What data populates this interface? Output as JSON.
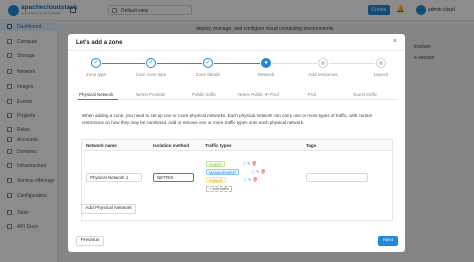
{
  "header": {
    "logo_text": "apachecloudstack",
    "logo_sub": "open source cloud computing",
    "view_select": "Default view",
    "create_label": "Create",
    "user_name": "admin cloud"
  },
  "sidebar": {
    "items": [
      {
        "label": "Dashboard",
        "icon": "dashboard-icon",
        "active": true
      },
      {
        "label": "Compute",
        "icon": "cloud-icon"
      },
      {
        "label": "Storage",
        "icon": "database-icon"
      },
      {
        "label": "Network",
        "icon": "wifi-icon"
      },
      {
        "label": "Images",
        "icon": "picture-icon"
      },
      {
        "label": "Events",
        "icon": "schedule-icon"
      },
      {
        "label": "Projects",
        "icon": "project-icon"
      },
      {
        "label": "Roles",
        "icon": "idcard-icon"
      },
      {
        "label": "Accounts",
        "icon": "team-icon"
      },
      {
        "label": "Domains",
        "icon": "block-icon"
      },
      {
        "label": "Infrastructure",
        "icon": "bank-icon"
      },
      {
        "label": "Service offerings",
        "icon": "shopping-icon"
      },
      {
        "label": "Configuration",
        "icon": "setting-icon"
      },
      {
        "label": "Tools",
        "icon": "tool-icon"
      },
      {
        "label": "API Docs",
        "icon": "read-icon"
      }
    ]
  },
  "background_text": {
    "line1": "deploy, manage, and configure cloud computing environments",
    "right1": "tructure",
    "right2": "e version"
  },
  "modal": {
    "title": "Let's add a zone",
    "close_glyph": "×",
    "steps": [
      {
        "label": "Zone type",
        "state": "done"
      },
      {
        "label": "Core zone type",
        "state": "done"
      },
      {
        "label": "Zone details",
        "state": "done"
      },
      {
        "label": "Network",
        "state": "current"
      },
      {
        "label": "Add resources",
        "state": "pending"
      },
      {
        "label": "Launch",
        "state": "pending"
      }
    ],
    "subtabs": [
      "Physical Network",
      "Netris Provider",
      "Public traffic",
      "Netris Public IP Pool",
      "Pod",
      "Guest traffic"
    ],
    "description": {
      "line1": "When adding a zone, you need to set up one or more physical networks. Each physical network can carry one or more types of traffic, with certain",
      "line2": "restrictions on how they may be combined. Add or remove one or more traffic types onto each physical network."
    },
    "table": {
      "headers": [
        "Network name",
        "Isolation method",
        "Traffic types",
        "Tags"
      ],
      "rows": [
        {
          "network_name": "Physical Network 1",
          "isolation_method": "NETRIS",
          "traffic_types": [
            {
              "label": "GUEST",
              "color": "#52c41a",
              "bg": "#f6ffed",
              "border": "#b7eb8f"
            },
            {
              "label": "MANAGEMENT",
              "color": "#1e8bd6",
              "bg": "#e6f4ff",
              "border": "#91caff"
            },
            {
              "label": "PUBLIC",
              "color": "#d48806",
              "bg": "#fffbe6",
              "border": "#ffe58f"
            }
          ],
          "add_traffic_label": "+ Add traffic",
          "tags": ""
        }
      ]
    },
    "add_network_label": "Add Physical Network",
    "previous_label": "Previous",
    "next_label": "Next"
  },
  "colors": {
    "primary": "#1e8bd6"
  }
}
